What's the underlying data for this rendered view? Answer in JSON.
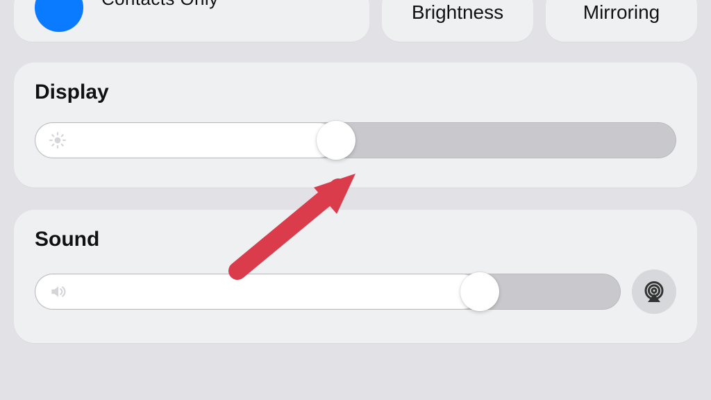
{
  "top": {
    "airdrop_subtitle": "Contacts Only",
    "brightness_label": "Brightness",
    "mirroring_label": "Mirroring"
  },
  "display": {
    "title": "Display",
    "value_percent": 47
  },
  "sound": {
    "title": "Sound",
    "value_percent": 76
  },
  "annotation": {
    "arrow_color": "#da3c4c"
  }
}
